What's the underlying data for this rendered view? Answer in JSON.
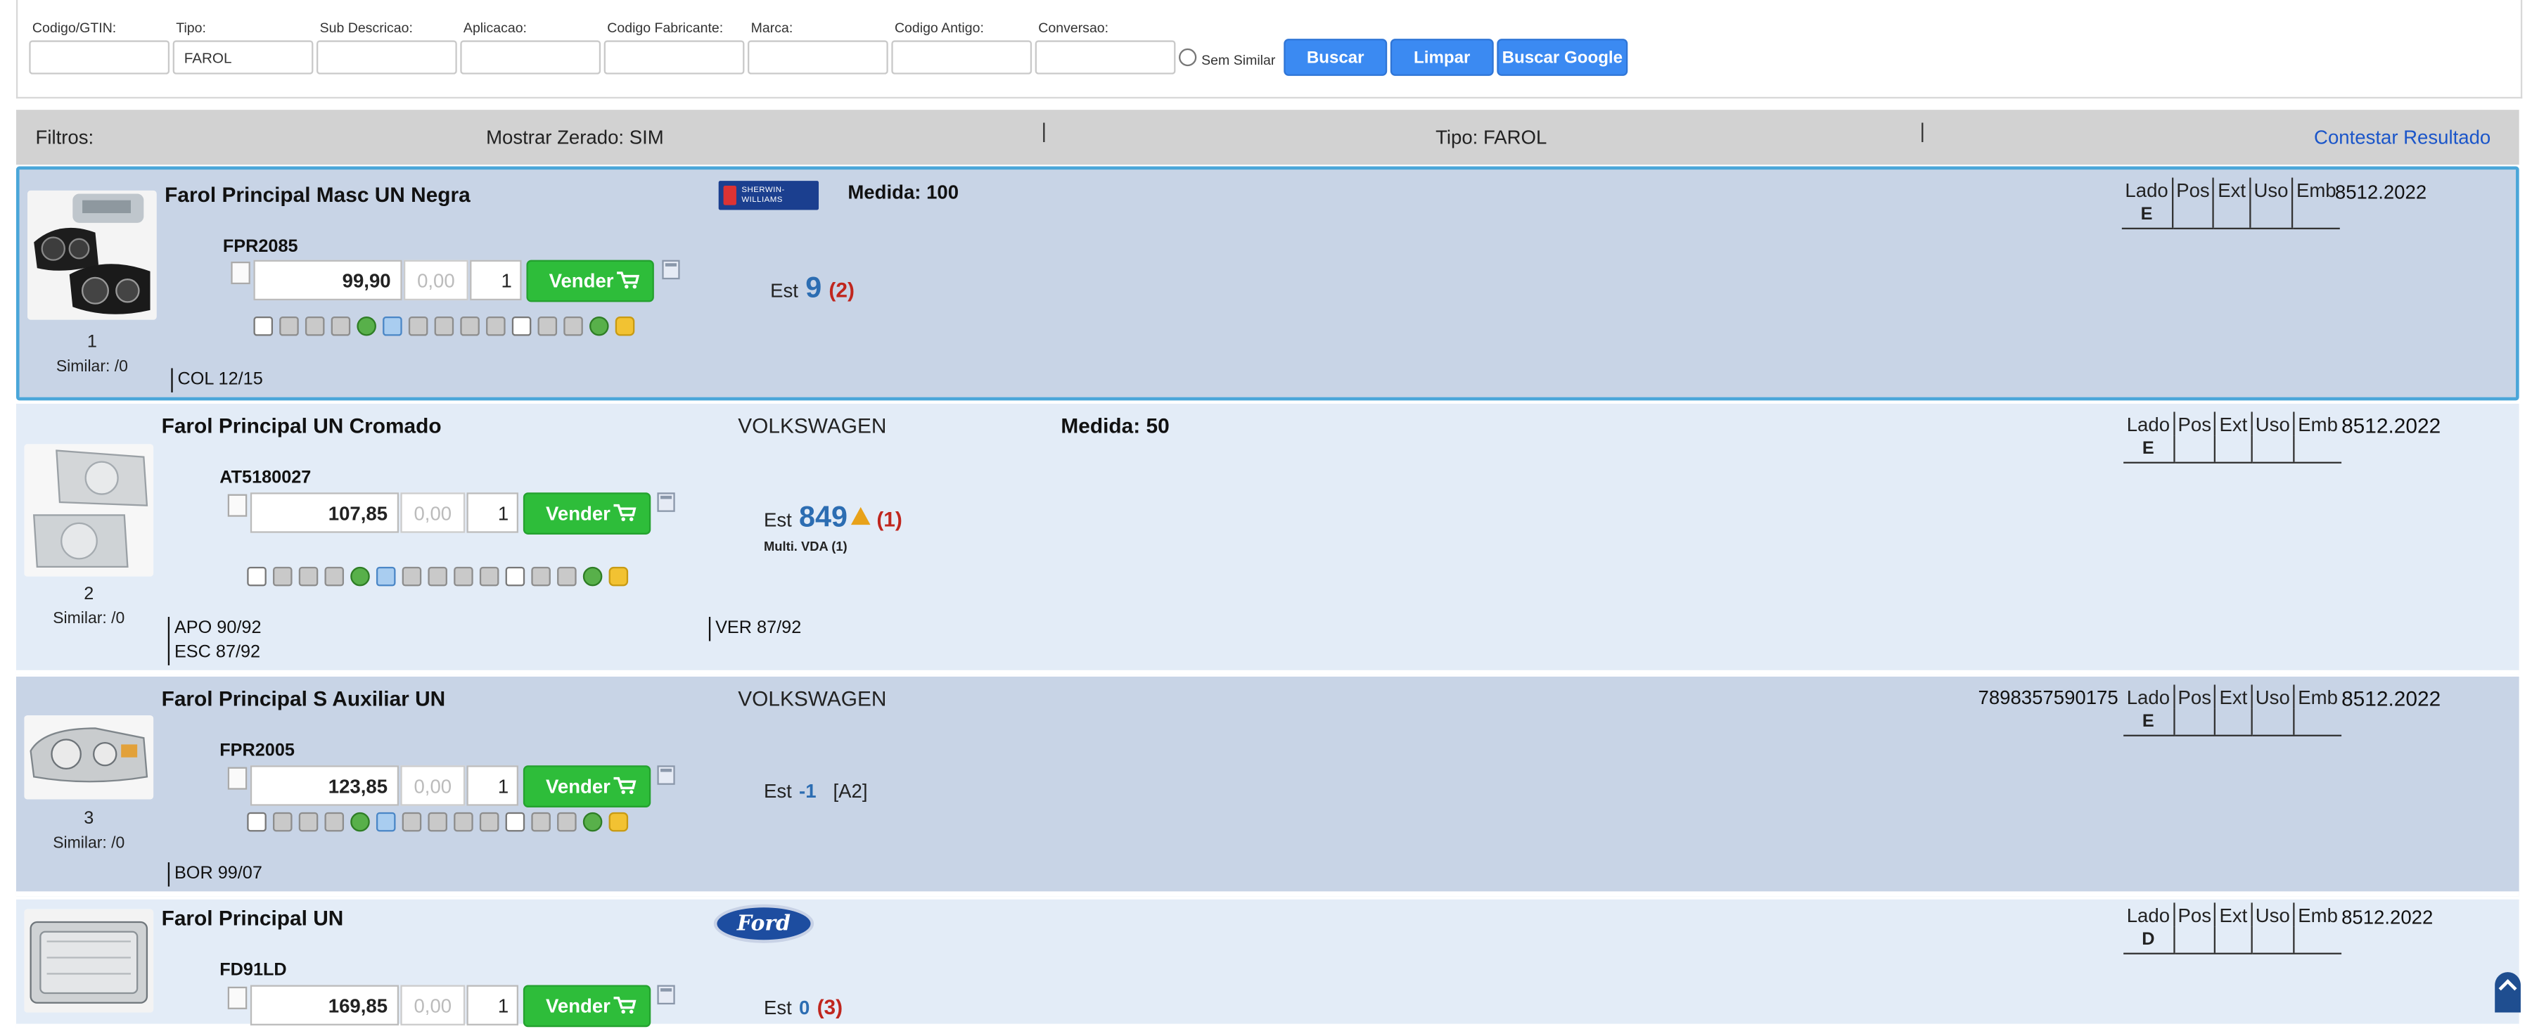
{
  "search": {
    "labels": {
      "codigo": "Codigo/GTIN:",
      "tipo": "Tipo:",
      "sub": "Sub Descricao:",
      "aplicacao": "Aplicacao:",
      "fabricante": "Codigo Fabricante:",
      "marca": "Marca:",
      "antigo": "Codigo Antigo:",
      "conversao": "Conversao:"
    },
    "values": {
      "codigo": "",
      "tipo": "FAROL",
      "sub": "",
      "aplicacao": "",
      "fabricante": "",
      "marca": "",
      "antigo": "",
      "conversao": ""
    },
    "sem_similar": "Sem Similar",
    "buttons": {
      "buscar": "Buscar",
      "limpar": "Limpar",
      "google": "Buscar Google"
    },
    "accent": "#3b8af2"
  },
  "filters": {
    "label": "Filtros:",
    "zerado": "Mostrar Zerado: SIM",
    "tipo": "Tipo: FAROL",
    "contestar": "Contestar Resultado"
  },
  "spec_headers": [
    "Lado",
    "Pos",
    "Ext",
    "Uso",
    "Emb"
  ],
  "vender_label": "Vender",
  "products": [
    {
      "index": "1",
      "similar": "Similar: /0",
      "title": "Farol Principal Masc UN Negra",
      "code": "FPR2085",
      "price": "99,90",
      "discount": "0,00",
      "qty": "1",
      "brand_logo": "SHERWIN-WILLIAMS",
      "medida": "Medida: 100",
      "est_label": "Est",
      "est_value": "9",
      "est_branches": "(2)",
      "lado": "E",
      "ncm": "8512.2022",
      "applications": [
        "COL 12/15"
      ]
    },
    {
      "index": "2",
      "similar": "Similar: /0",
      "title": "Farol Principal UN Cromado",
      "code": "AT5180027",
      "price": "107,85",
      "discount": "0,00",
      "qty": "1",
      "brand": "VOLKSWAGEN",
      "medida": "Medida: 50",
      "est_label": "Est",
      "est_value": "849",
      "est_branches": "(1)",
      "multi": "Multi. VDA (1)",
      "lado": "E",
      "ncm": "8512.2022",
      "applications_left": [
        "APO 90/92",
        "ESC 87/92"
      ],
      "applications_right": [
        "VER 87/92"
      ]
    },
    {
      "index": "3",
      "similar": "Similar: /0",
      "title": "Farol Principal S Auxiliar UN",
      "code": "FPR2005",
      "price": "123,85",
      "discount": "0,00",
      "qty": "1",
      "brand": "VOLKSWAGEN",
      "gtin": "7898357590175",
      "est_label": "Est",
      "est_value": "-1",
      "est_loc": "[A2]",
      "lado": "E",
      "ncm": "8512.2022",
      "applications": [
        "BOR 99/07"
      ]
    },
    {
      "title": "Farol Principal UN",
      "code": "FD91LD",
      "price": "169,85",
      "discount": "0,00",
      "qty": "1",
      "brand_logo": "Ford",
      "est_label": "Est",
      "est_value": "0",
      "est_branches": "(3)",
      "lado": "D",
      "ncm": "8512.2022"
    }
  ]
}
